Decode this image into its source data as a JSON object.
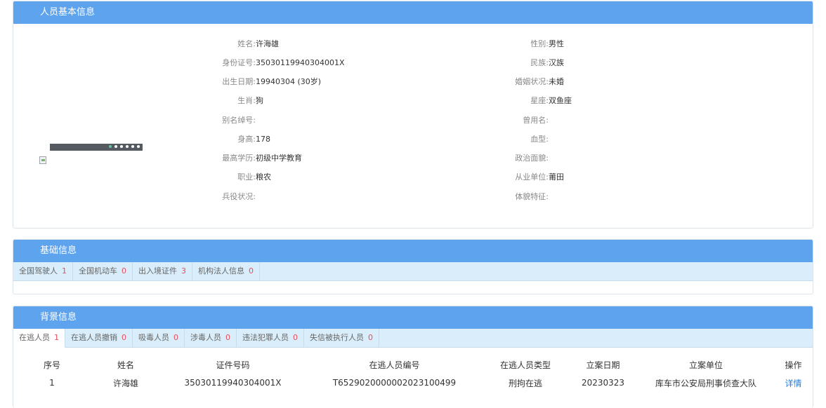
{
  "person_panel": {
    "title": "人员基本信息",
    "left_fields": [
      {
        "label": "姓名:",
        "value": "许海雄"
      },
      {
        "label": "身份证号:",
        "value": "35030119940304001X"
      },
      {
        "label": "出生日期:",
        "value": "19940304 (30岁)"
      },
      {
        "label": "生肖:",
        "value": "狗"
      },
      {
        "label": "别名绰号:",
        "value": ""
      },
      {
        "label": "身高:",
        "value": "178"
      },
      {
        "label": "最高学历:",
        "value": "初级中学教育"
      },
      {
        "label": "职业:",
        "value": "粮农"
      },
      {
        "label": "兵役状况:",
        "value": ""
      }
    ],
    "right_fields": [
      {
        "label": "性别:",
        "value": "男性"
      },
      {
        "label": "民族:",
        "value": "汉族"
      },
      {
        "label": "婚姻状况:",
        "value": "未婚"
      },
      {
        "label": "星座:",
        "value": "双鱼座"
      },
      {
        "label": "曾用名:",
        "value": ""
      },
      {
        "label": "血型:",
        "value": ""
      },
      {
        "label": "政治面貌:",
        "value": ""
      },
      {
        "label": "从业单位:",
        "value": "莆田"
      },
      {
        "label": "体貌特征:",
        "value": ""
      }
    ]
  },
  "basic_panel": {
    "title": "基础信息",
    "tabs": [
      {
        "label": "全国驾驶人",
        "count": "1"
      },
      {
        "label": "全国机动车",
        "count": "0"
      },
      {
        "label": "出入境证件",
        "count": "3"
      },
      {
        "label": "机构法人信息",
        "count": "0"
      }
    ]
  },
  "background_panel": {
    "title": "背景信息",
    "tabs": [
      {
        "label": "在逃人员",
        "count": "1"
      },
      {
        "label": "在逃人员撤销",
        "count": "0"
      },
      {
        "label": "吸毒人员",
        "count": "0"
      },
      {
        "label": "涉毒人员",
        "count": "0"
      },
      {
        "label": "违法犯罪人员",
        "count": "0"
      },
      {
        "label": "失信被执行人员",
        "count": "0"
      }
    ],
    "table": {
      "headers": [
        "序号",
        "姓名",
        "证件号码",
        "在逃人员编号",
        "在逃人员类型",
        "立案日期",
        "立案单位",
        "操作"
      ],
      "rows": [
        [
          "1",
          "许海雄",
          "35030119940304001X",
          "T6529020000002023100499",
          "刑拘在逃",
          "20230323",
          "库车市公安局刑事侦查大队",
          "详情"
        ]
      ]
    }
  }
}
